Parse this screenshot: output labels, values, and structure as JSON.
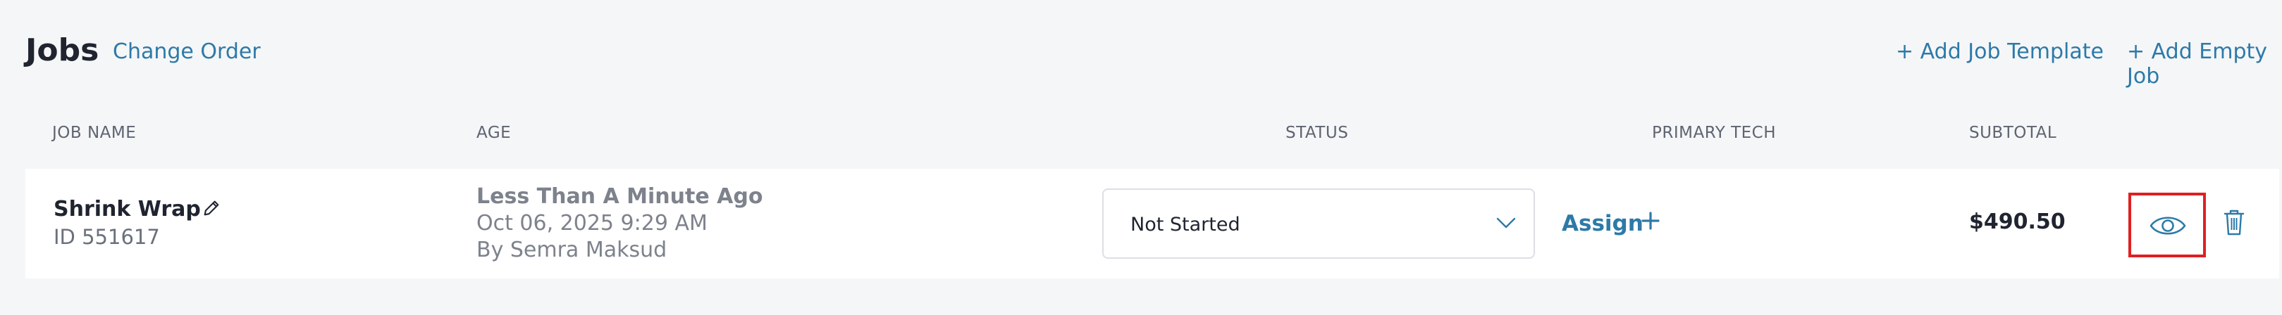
{
  "header": {
    "title": "Jobs",
    "change_order": "Change Order",
    "add_job_template": "+ Add Job Template",
    "add_empty_job": "+ Add Empty Job"
  },
  "columns": {
    "job_name": "JOB NAME",
    "age": "AGE",
    "status": "STATUS",
    "primary_tech": "PRIMARY TECH",
    "subtotal": "SUBTOTAL"
  },
  "job": {
    "name": "Shrink Wrap",
    "id": "ID 551617",
    "age_relative": "Less Than A Minute Ago",
    "age_date": "Oct 06, 2025 9:29 AM",
    "created_by": "By Semra Maksud",
    "status": "Not Started",
    "assign_label": "Assign",
    "subtotal": "$490.50"
  },
  "icons": {
    "edit": "pencil-icon",
    "status_dropdown": "chevron-down-icon",
    "assign_add": "plus-icon",
    "view": "eye-icon",
    "delete": "trash-icon"
  },
  "colors": {
    "accent": "#2d7aa8",
    "highlight": "#e02020",
    "background": "#f5f6f8",
    "row_background": "#ffffff"
  }
}
